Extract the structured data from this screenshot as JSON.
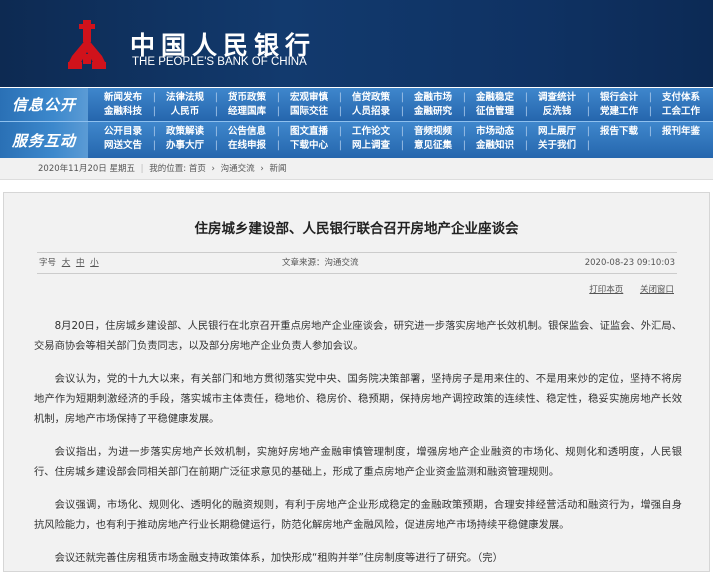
{
  "header": {
    "logo_cn": "中国人民银行",
    "logo_en": "THE PEOPLE'S BANK OF CHINA",
    "brand_red": "#d0121b"
  },
  "nav": {
    "info": {
      "label": "信息公开",
      "items": [
        "新闻发布",
        "法律法规",
        "货币政策",
        "宏观审慎",
        "信贷政策",
        "金融市场",
        "金融稳定",
        "调查统计",
        "银行会计",
        "支付体系",
        "金融科技",
        "人民币",
        "经理国库",
        "国际交往",
        "人员招录",
        "金融研究",
        "征信管理",
        "反洗钱",
        "党建工作",
        "工会工作"
      ]
    },
    "service": {
      "label": "服务互动",
      "items": [
        "公开目录",
        "政策解读",
        "公告信息",
        "图文直播",
        "工作论文",
        "音频视频",
        "市场动态",
        "网上展厅",
        "报告下载",
        "报刊年鉴",
        "网送文告",
        "办事大厅",
        "在线申报",
        "下载中心",
        "网上调查",
        "意见征集",
        "金融知识",
        "关于我们"
      ]
    }
  },
  "breadcrumb": {
    "date": "2020年11月20日 星期五",
    "sep": "|",
    "location": "我的位置:",
    "items": [
      "首页",
      "沟通交流",
      "新闻"
    ],
    "arrow": "›"
  },
  "article": {
    "title": "住房城乡建设部、人民银行联合召开房地产企业座谈会",
    "font_size_label": "字号",
    "font_sizes": [
      "大",
      "中",
      "小"
    ],
    "source": "文章来源：沟通交流",
    "datetime": "2020-08-23 09:10:03",
    "print": "打印本页",
    "close": "关闭窗口",
    "paragraphs": [
      "8月20日，住房城乡建设部、人民银行在北京召开重点房地产企业座谈会，研究进一步落实房地产长效机制。银保监会、证监会、外汇局、交易商协会等相关部门负责同志，以及部分房地产企业负责人参加会议。",
      "会议认为，党的十九大以来，有关部门和地方贯彻落实党中央、国务院决策部署，坚持房子是用来住的、不是用来炒的定位，坚持不将房地产作为短期刺激经济的手段，落实城市主体责任，稳地价、稳房价、稳预期，保持房地产调控政策的连续性、稳定性，稳妥实施房地产长效机制，房地产市场保持了平稳健康发展。",
      "会议指出，为进一步落实房地产长效机制，实施好房地产金融审慎管理制度，增强房地产企业融资的市场化、规则化和透明度，人民银行、住房城乡建设部会同相关部门在前期广泛征求意见的基础上，形成了重点房地产企业资金监测和融资管理规则。",
      "会议强调，市场化、规则化、透明化的融资规则，有利于房地产企业形成稳定的金融政策预期，合理安排经营活动和融资行为，增强自身抗风险能力，也有利于推动房地产行业长期稳健运行，防范化解房地产金融风险，促进房地产市场持续平稳健康发展。",
      "会议还就完善住房租赁市场金融支持政策体系，加快形成“租购并举”住房制度等进行了研究。（完）"
    ]
  }
}
